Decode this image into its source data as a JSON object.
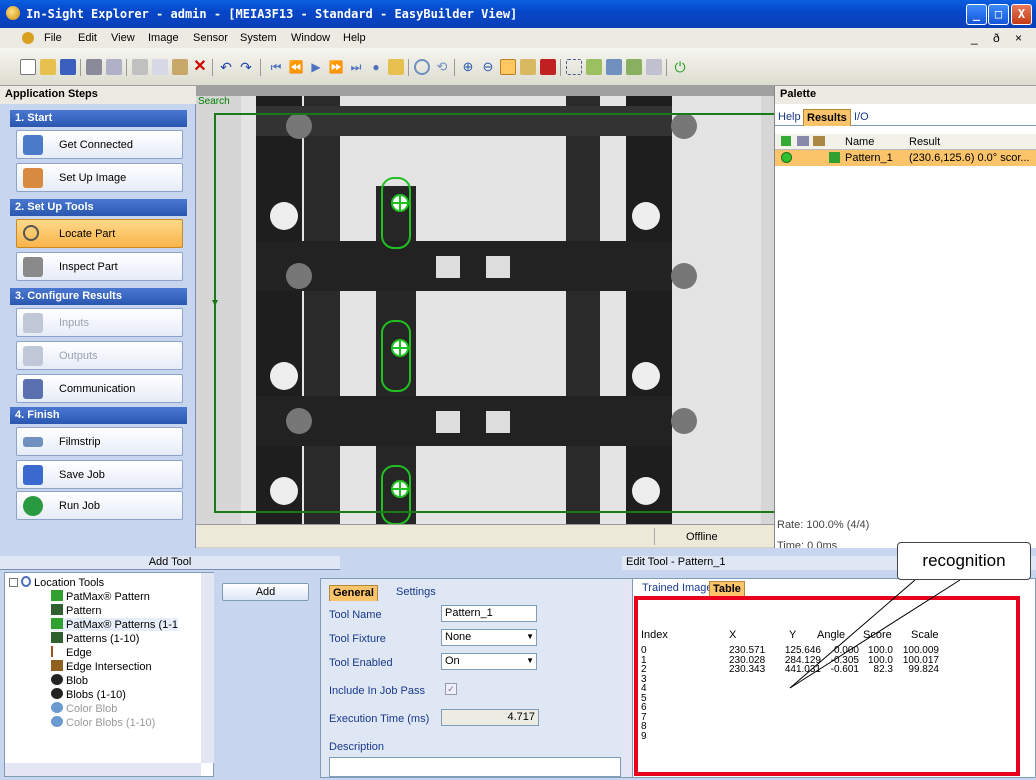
{
  "window": {
    "title": "In-Sight Explorer - admin - [MEIA3F13 - Standard - EasyBuilder View]",
    "min": "_",
    "max": "□",
    "close": "X"
  },
  "menu": [
    "File",
    "Edit",
    "View",
    "Image",
    "Sensor",
    "System",
    "Window",
    "Help"
  ],
  "menu_right": "_ ð ×",
  "app_steps": {
    "title": "Application Steps",
    "sections": [
      {
        "label": "1. Start",
        "items": [
          "Get Connected",
          "Set Up Image"
        ]
      },
      {
        "label": "2. Set Up Tools",
        "items": [
          "Locate Part",
          "Inspect Part"
        ]
      },
      {
        "label": "3. Configure Results",
        "items": [
          "Inputs",
          "Outputs",
          "Communication"
        ]
      },
      {
        "label": "4. Finish",
        "items": [
          "Filmstrip",
          "Save Job",
          "Run Job"
        ]
      }
    ]
  },
  "viewer": {
    "search_label": "Search",
    "status": "Offline"
  },
  "palette": {
    "title": "Palette",
    "tabs": [
      "Help",
      "Results",
      "I/O"
    ],
    "columns": [
      "Name",
      "Result"
    ],
    "row": {
      "name": "Pattern_1",
      "result": "(230.6,125.6) 0.0° scor..."
    },
    "rate": "Rate: 100.0% (4/4)",
    "time": "Time: 0.0ms"
  },
  "add_tool": {
    "header": "Add Tool",
    "add_button": "Add",
    "tree": [
      {
        "label": "Location Tools",
        "level": 0,
        "disabled": false
      },
      {
        "label": "PatMax® Pattern",
        "level": 1,
        "disabled": false
      },
      {
        "label": "Pattern",
        "level": 1,
        "disabled": false
      },
      {
        "label": "PatMax® Patterns (1-1",
        "level": 1,
        "disabled": false
      },
      {
        "label": "Patterns (1-10)",
        "level": 1,
        "disabled": false
      },
      {
        "label": "Edge",
        "level": 1,
        "disabled": false
      },
      {
        "label": "Edge Intersection",
        "level": 1,
        "disabled": false
      },
      {
        "label": "Blob",
        "level": 1,
        "disabled": false
      },
      {
        "label": "Blobs (1-10)",
        "level": 1,
        "disabled": false
      },
      {
        "label": "Color Blob",
        "level": 1,
        "disabled": true
      },
      {
        "label": "Color Blobs (1-10)",
        "level": 1,
        "disabled": true
      }
    ]
  },
  "edit_tool": {
    "header": "Edit Tool - Pattern_1",
    "tabs": [
      "General",
      "Settings"
    ],
    "fields": {
      "tool_name_label": "Tool Name",
      "tool_name": "Pattern_1",
      "fixture_label": "Tool Fixture",
      "fixture": "None",
      "enabled_label": "Tool Enabled",
      "enabled": "On",
      "include_label": "Include In Job Pass",
      "exec_label": "Execution Time (ms)",
      "exec": "4.717",
      "desc_label": "Description"
    },
    "table_tabs": [
      "Trained Image",
      "Table"
    ],
    "table": {
      "headers": [
        "Index",
        "X",
        "Y",
        "Angle",
        "Score",
        "Scale"
      ],
      "rows": [
        [
          "0",
          "230.571",
          "125.646",
          "0.000",
          "100.0",
          "100.009"
        ],
        [
          "1",
          "230.028",
          "284.129",
          "-0.305",
          "100.0",
          "100.017"
        ],
        [
          "2",
          "230.343",
          "441.031",
          "-0.601",
          "82.3",
          "99.824"
        ],
        [
          "3",
          "",
          "",
          "",
          "",
          ""
        ],
        [
          "4",
          "",
          "",
          "",
          "",
          ""
        ],
        [
          "5",
          "",
          "",
          "",
          "",
          ""
        ],
        [
          "6",
          "",
          "",
          "",
          "",
          ""
        ],
        [
          "7",
          "",
          "",
          "",
          "",
          ""
        ],
        [
          "8",
          "",
          "",
          "",
          "",
          ""
        ],
        [
          "9",
          "",
          "",
          "",
          "",
          ""
        ]
      ]
    }
  },
  "callout": "recognition"
}
